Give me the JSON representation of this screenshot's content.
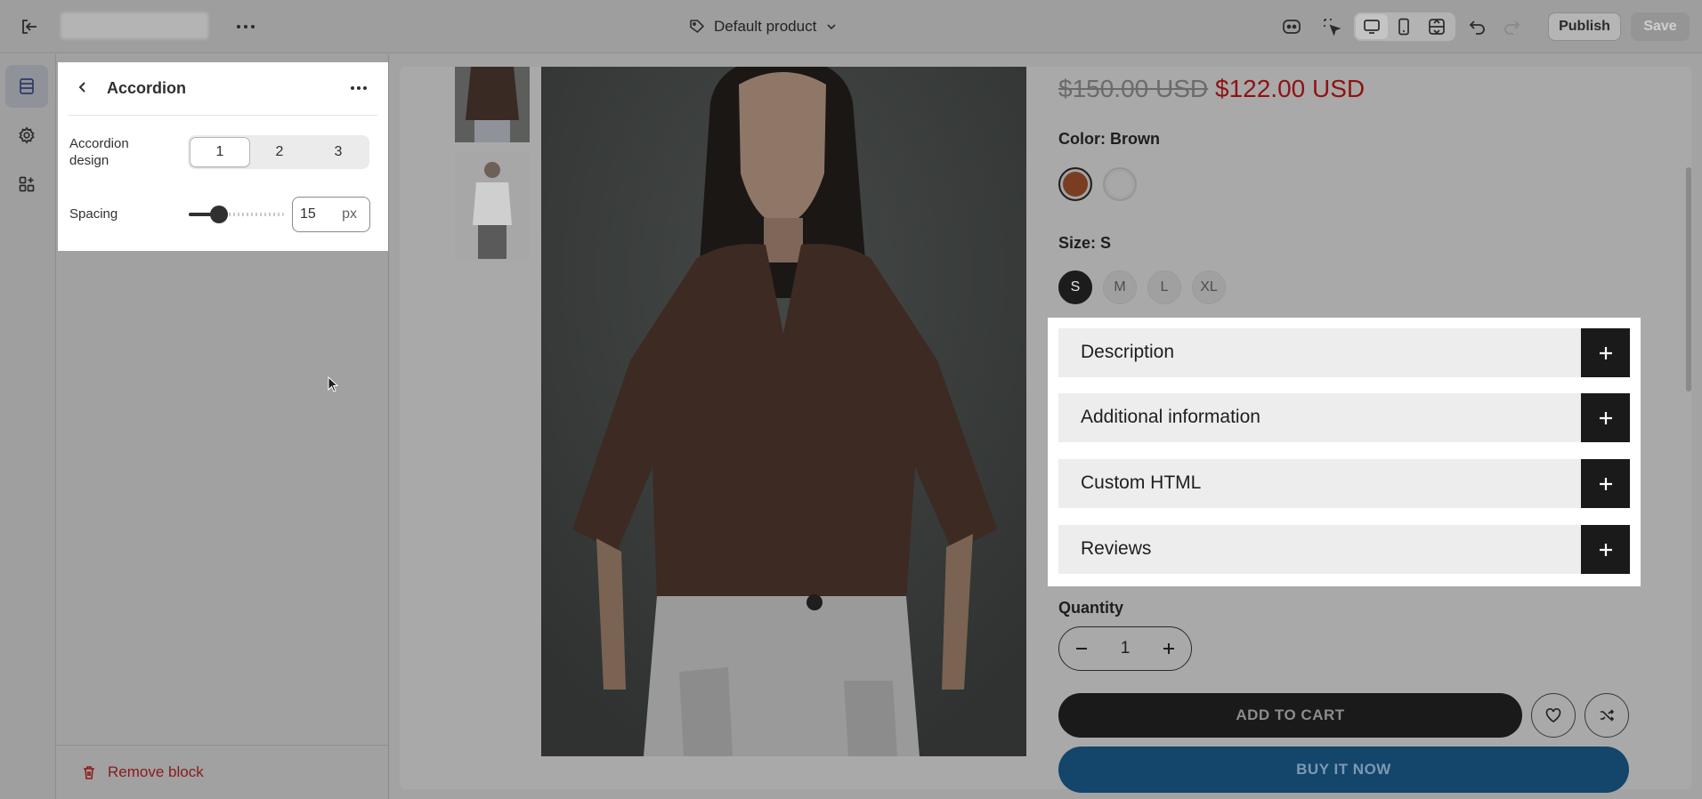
{
  "topbar": {
    "product_selector": "Default product",
    "publish_label": "Publish",
    "save_label": "Save"
  },
  "rail": {
    "items": [
      "sections-icon",
      "gear-icon",
      "apps-icon"
    ]
  },
  "panel": {
    "title": "Accordion",
    "accordion_design_label": "Accordion\ndesign",
    "design_options": [
      "1",
      "2",
      "3"
    ],
    "design_selected": "1",
    "spacing_label": "Spacing",
    "spacing_value": "15",
    "spacing_unit": "px",
    "remove_block_label": "Remove block"
  },
  "product": {
    "price_compare": "$150.00 USD",
    "price": "$122.00 USD",
    "color_label": "Color: Brown",
    "swatch_colors": [
      "#7a3d22",
      "#a8a8a8"
    ],
    "size_label": "Size: S",
    "sizes": [
      "S",
      "M",
      "L",
      "XL"
    ],
    "size_selected": "S",
    "accordion_items": [
      "Description",
      "Additional information",
      "Custom HTML",
      "Reviews"
    ],
    "quantity_label": "Quantity",
    "quantity_value": "1",
    "add_to_cart_label": "ADD TO CART",
    "buy_now_label": "BUY IT NOW"
  },
  "colors": {
    "accent_buy": "#14456b",
    "sale_price": "#8f1212",
    "overlay_gray": "#a3a3a3"
  }
}
